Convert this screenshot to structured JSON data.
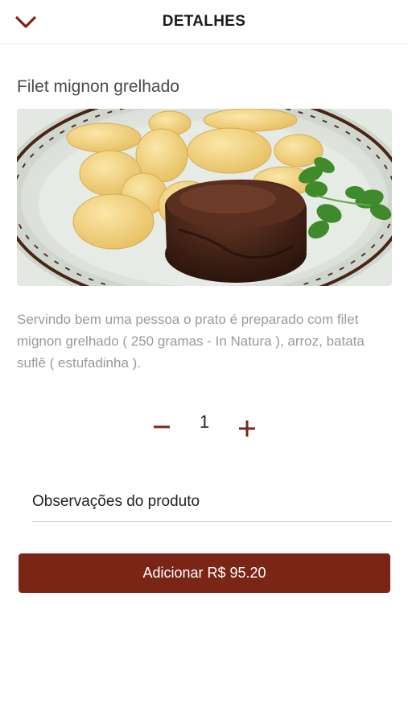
{
  "header": {
    "title": "DETALHES",
    "back_icon": "chevron-down-icon"
  },
  "product": {
    "name": "Filet mignon grelhado",
    "description": "Servindo bem uma pessoa o prato é preparado com filet mignon grelhado ( 250 gramas - In Natura ), arroz, batata suflê ( estufadinha )."
  },
  "quantity": {
    "value": "1",
    "minus_icon": "minus-icon",
    "plus_icon": "plus-icon"
  },
  "notes": {
    "placeholder": "Observações do produto"
  },
  "add_button": {
    "label": "Adicionar R$ 95.20"
  },
  "colors": {
    "accent": "#7b2517",
    "text": "#222222",
    "muted": "#9a9a9a"
  }
}
